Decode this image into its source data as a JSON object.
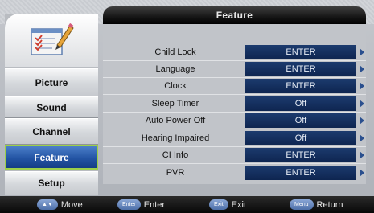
{
  "header": {
    "title": "Feature"
  },
  "sidebar": {
    "icon": "checklist-pencil-icon",
    "items": [
      {
        "label": "Picture",
        "active": false
      },
      {
        "label": "Sound",
        "active": false
      },
      {
        "label": "Channel",
        "active": false
      },
      {
        "label": "Feature",
        "active": true
      },
      {
        "label": "Setup",
        "active": false
      }
    ]
  },
  "settings": [
    {
      "label": "Child Lock",
      "value": "ENTER"
    },
    {
      "label": "Language",
      "value": "ENTER"
    },
    {
      "label": "Clock",
      "value": "ENTER"
    },
    {
      "label": "Sleep Timer",
      "value": "Off"
    },
    {
      "label": "Auto Power Off",
      "value": "Off"
    },
    {
      "label": "Hearing Impaired",
      "value": "Off"
    },
    {
      "label": "CI Info",
      "value": "ENTER"
    },
    {
      "label": "PVR",
      "value": "ENTER"
    }
  ],
  "hints": [
    {
      "key": "▲▼",
      "label": "Move"
    },
    {
      "key": "Enter",
      "label": "Enter"
    },
    {
      "key": "Exit",
      "label": "Exit"
    },
    {
      "key": "Menu",
      "label": "Return"
    }
  ],
  "colors": {
    "active_accent": "#9ccf4a",
    "value_box": "#0e2550",
    "title_bar": "#161616"
  }
}
